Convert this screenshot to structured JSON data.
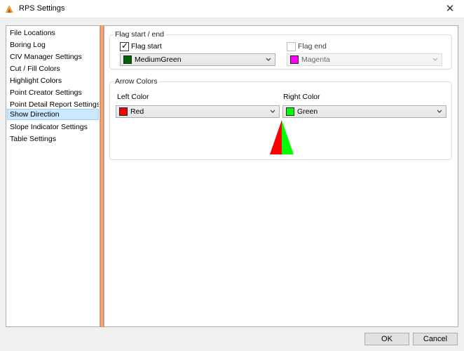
{
  "window": {
    "title": "RPS Settings"
  },
  "nav": {
    "items": [
      {
        "label": "File Locations"
      },
      {
        "label": "Boring Log"
      },
      {
        "label": "CIV Manager Settings"
      },
      {
        "label": "Cut / Fill Colors"
      },
      {
        "label": "Highlight Colors"
      },
      {
        "label": "Point Creator Settings"
      },
      {
        "label": "Point Detail Report Settings"
      },
      {
        "label": "Show Direction"
      },
      {
        "label": "Slope Indicator Settings"
      },
      {
        "label": "Table Settings"
      }
    ],
    "selected": "Show Direction"
  },
  "flag_group": {
    "legend": "Flag start / end",
    "start": {
      "label": "Flag start",
      "checked": true,
      "color_name": "MediumGreen",
      "color": "#006400"
    },
    "end": {
      "label": "Flag end",
      "checked": false,
      "color_name": "Magenta",
      "color": "#ff00ff"
    }
  },
  "arrow_group": {
    "legend": "Arrow Colors",
    "left": {
      "label": "Left Color",
      "color_name": "Red",
      "color": "#ff0000"
    },
    "right": {
      "label": "Right Color",
      "color_name": "Green",
      "color": "#00ff00"
    }
  },
  "footer": {
    "ok_label": "OK",
    "cancel_label": "Cancel"
  }
}
